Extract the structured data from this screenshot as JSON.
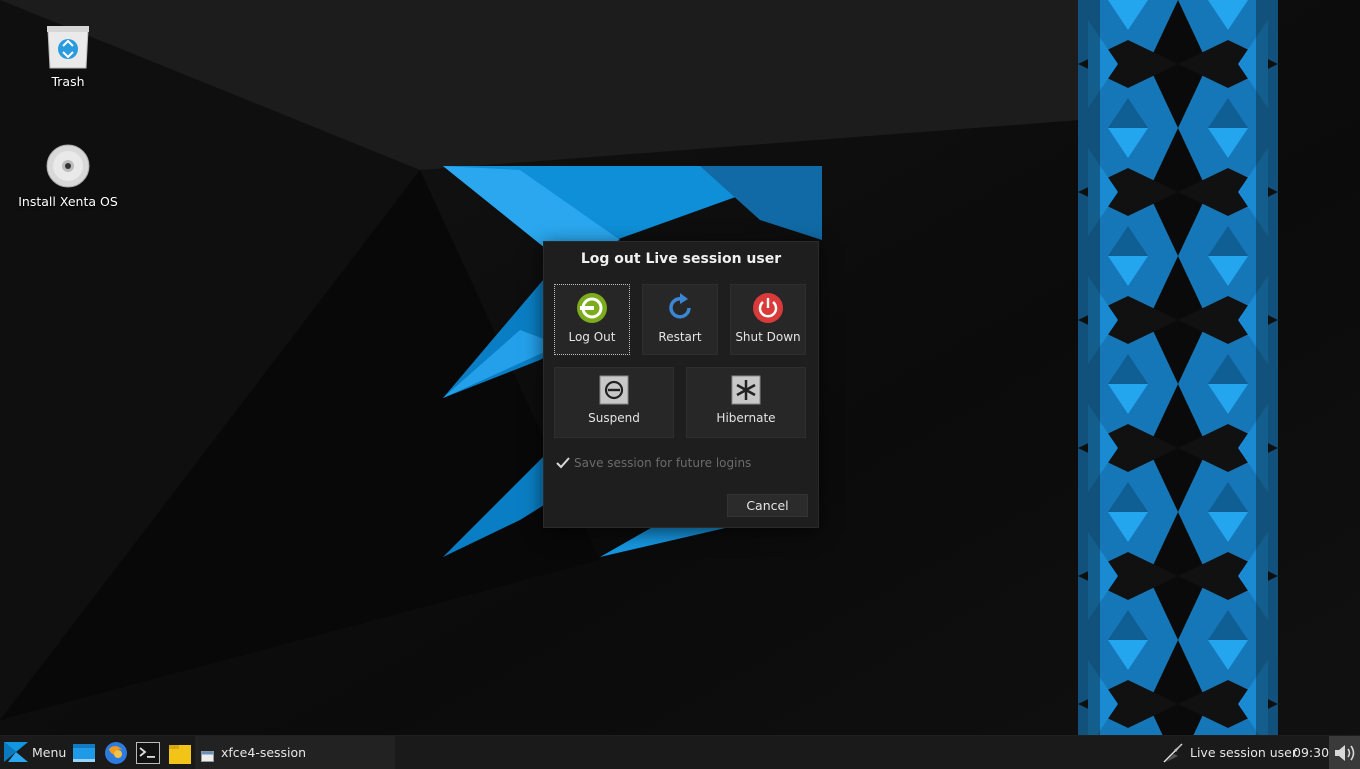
{
  "desktop": {
    "icons": [
      {
        "label": "Trash",
        "icon": "trash-icon"
      },
      {
        "label": "Install Xenta OS",
        "icon": "disc-icon"
      }
    ]
  },
  "dialog": {
    "title": "Log out Live session user",
    "actions": [
      {
        "label": "Log Out",
        "icon": "logout-icon",
        "color": "#7cab1b"
      },
      {
        "label": "Restart",
        "icon": "restart-icon",
        "color": "#3b86d4"
      },
      {
        "label": "Shut Down",
        "icon": "power-icon",
        "color": "#d93a3a"
      },
      {
        "label": "Suspend",
        "icon": "suspend-icon",
        "color": "#9e9e9e"
      },
      {
        "label": "Hibernate",
        "icon": "hibernate-icon",
        "color": "#9e9e9e"
      }
    ],
    "save_session": {
      "label": "Save session for future logins",
      "checked": true,
      "enabled": false
    },
    "cancel_label": "Cancel"
  },
  "taskbar": {
    "menu_label": "Menu",
    "launchers": [
      "file-manager-icon",
      "web-browser-icon",
      "terminal-icon",
      "folder-icon"
    ],
    "task_label": "xfce4-session",
    "user_label": "Live session user",
    "clock": "09:30",
    "volume_icon": "volume-icon"
  },
  "colors": {
    "accent": "#0e8fd8",
    "background": "#0d0d0d",
    "dialog_bg": "#1e1e1e",
    "taskbar_bg": "#1a1a1a"
  }
}
